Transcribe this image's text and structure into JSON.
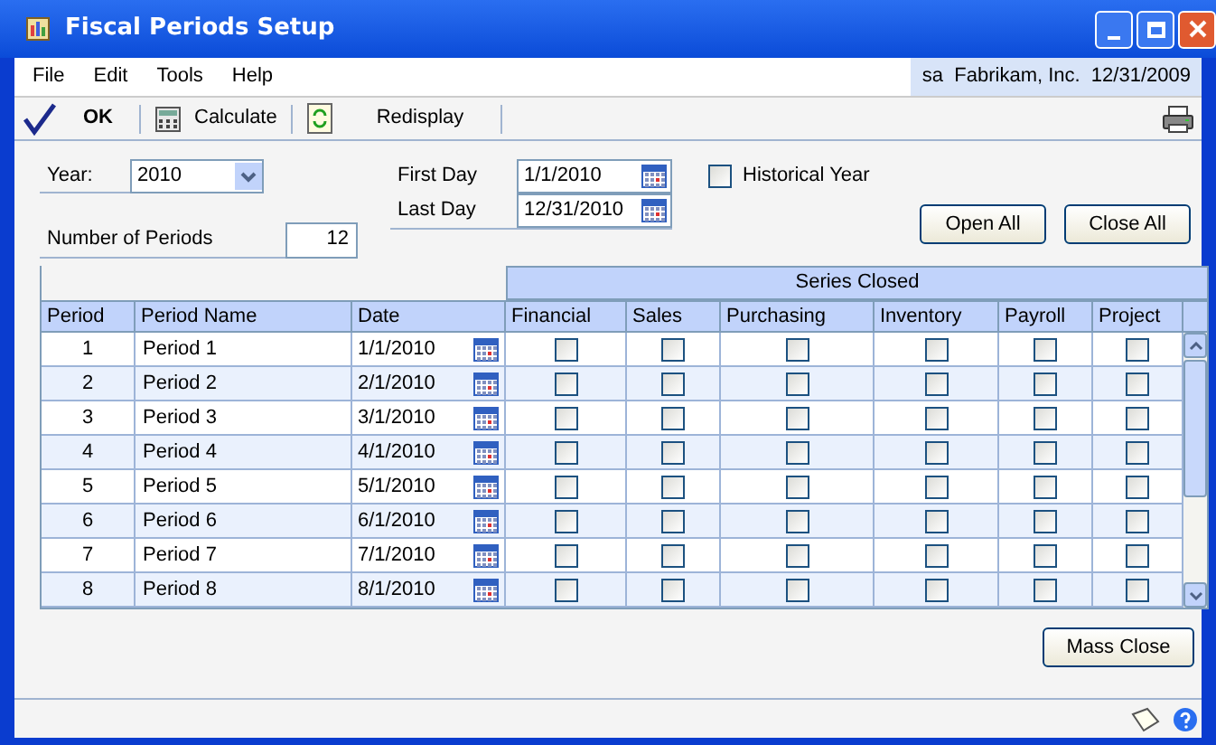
{
  "window": {
    "title": "Fiscal Periods Setup"
  },
  "menu": [
    "File",
    "Edit",
    "Tools",
    "Help"
  ],
  "user_info": "sa  Fabrikam, Inc.  12/31/2009",
  "toolbar": [
    {
      "kind": "ok",
      "label": "OK"
    },
    {
      "kind": "calculate",
      "label": "Calculate"
    },
    {
      "kind": "redisplay",
      "label": "Redisplay"
    }
  ],
  "year": {
    "label": "Year:",
    "value": "2010"
  },
  "first_day": {
    "label": "First Day",
    "value": "1/1/2010"
  },
  "last_day": {
    "label": "Last Day",
    "value": "12/31/2010"
  },
  "historical_year": {
    "label": "Historical Year",
    "checked": false
  },
  "number_of_periods": {
    "label": "Number of Periods",
    "value": "12"
  },
  "buttons": [
    "Open All",
    "Close All"
  ],
  "table": {
    "group_header": "Series Closed",
    "columns": [
      "Period",
      "Period Name",
      "Date",
      "Financial",
      "Sales",
      "Purchasing",
      "Inventory",
      "Payroll",
      "Project"
    ],
    "rows": [
      {
        "period": "1",
        "name": "Period 1",
        "date": "1/1/2010",
        "closed": [
          false,
          false,
          false,
          false,
          false,
          false
        ]
      },
      {
        "period": "2",
        "name": "Period 2",
        "date": "2/1/2010",
        "closed": [
          false,
          false,
          false,
          false,
          false,
          false
        ]
      },
      {
        "period": "3",
        "name": "Period 3",
        "date": "3/1/2010",
        "closed": [
          false,
          false,
          false,
          false,
          false,
          false
        ]
      },
      {
        "period": "4",
        "name": "Period 4",
        "date": "4/1/2010",
        "closed": [
          false,
          false,
          false,
          false,
          false,
          false
        ]
      },
      {
        "period": "5",
        "name": "Period 5",
        "date": "5/1/2010",
        "closed": [
          false,
          false,
          false,
          false,
          false,
          false
        ]
      },
      {
        "period": "6",
        "name": "Period 6",
        "date": "6/1/2010",
        "closed": [
          false,
          false,
          false,
          false,
          false,
          false
        ]
      },
      {
        "period": "7",
        "name": "Period 7",
        "date": "7/1/2010",
        "closed": [
          false,
          false,
          false,
          false,
          false,
          false
        ]
      },
      {
        "period": "8",
        "name": "Period 8",
        "date": "8/1/2010",
        "closed": [
          false,
          false,
          false,
          false,
          false,
          false
        ]
      }
    ]
  },
  "mass_close": "Mass Close"
}
